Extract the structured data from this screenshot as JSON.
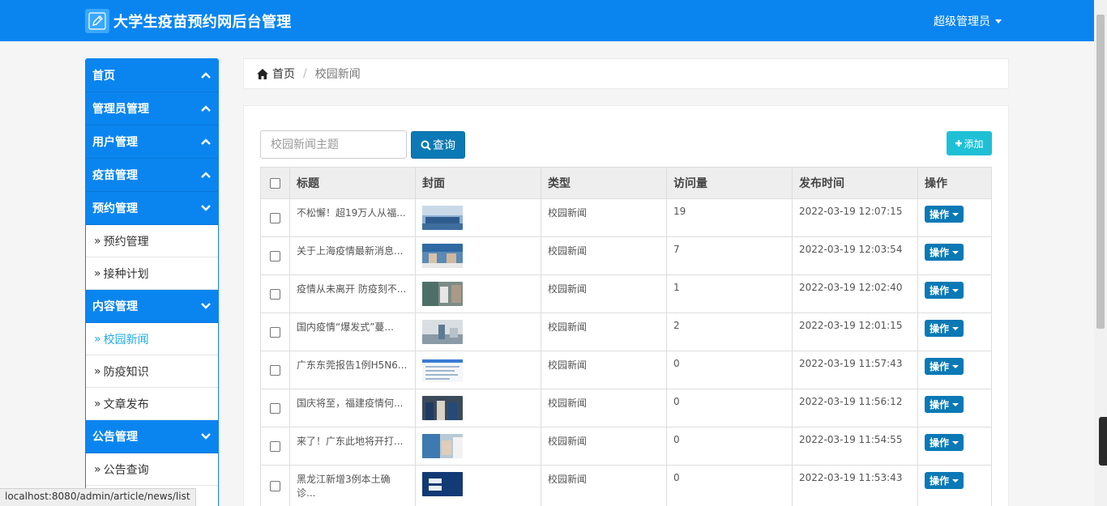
{
  "header": {
    "title": "大学生疫苗预约网后台管理",
    "user": "超级管理员"
  },
  "sidebar": {
    "sections": [
      {
        "label": "首页",
        "expanded": false,
        "items": []
      },
      {
        "label": "管理员管理",
        "expanded": false,
        "items": []
      },
      {
        "label": "用户管理",
        "expanded": false,
        "items": []
      },
      {
        "label": "疫苗管理",
        "expanded": false,
        "items": []
      },
      {
        "label": "预约管理",
        "expanded": true,
        "items": [
          "预约管理",
          "接种计划"
        ]
      },
      {
        "label": "内容管理",
        "expanded": true,
        "items": [
          "校园新闻",
          "防疫知识",
          "文章发布"
        ]
      },
      {
        "label": "公告管理",
        "expanded": true,
        "items": [
          "公告查询"
        ]
      }
    ],
    "active_item": "校园新闻"
  },
  "breadcrumb": {
    "home": "首页",
    "current": "校园新闻"
  },
  "search": {
    "placeholder": "校园新闻主题",
    "button": "查询"
  },
  "add_button": "添加",
  "table": {
    "columns": [
      "标题",
      "封面",
      "类型",
      "访问量",
      "发布时间",
      "操作"
    ],
    "rows": [
      {
        "title": "不松懈！超19万人从福...",
        "type": "校园新闻",
        "views": "19",
        "time": "2022-03-19 12:07:15",
        "action": "操作"
      },
      {
        "title": "关于上海疫情最新消息...",
        "type": "校园新闻",
        "views": "7",
        "time": "2022-03-19 12:03:54",
        "action": "操作"
      },
      {
        "title": "疫情从未离开 防疫刻不...",
        "type": "校园新闻",
        "views": "1",
        "time": "2022-03-19 12:02:40",
        "action": "操作"
      },
      {
        "title": "国内疫情“爆发式”蔓...",
        "type": "校园新闻",
        "views": "2",
        "time": "2022-03-19 12:01:15",
        "action": "操作"
      },
      {
        "title": "广东东莞报告1例H5N6...",
        "type": "校园新闻",
        "views": "0",
        "time": "2022-03-19 11:57:43",
        "action": "操作"
      },
      {
        "title": "国庆将至，福建疫情何...",
        "type": "校园新闻",
        "views": "0",
        "time": "2022-03-19 11:56:12",
        "action": "操作"
      },
      {
        "title": "来了！广东此地将开打...",
        "type": "校园新闻",
        "views": "0",
        "time": "2022-03-19 11:54:55",
        "action": "操作"
      },
      {
        "title": "黑龙江新增3例本土确诊...",
        "type": "校园新闻",
        "views": "0",
        "time": "2022-03-19 11:53:43",
        "action": "操作"
      }
    ]
  },
  "status_url": "localhost:8080/admin/article/news/list",
  "colors": {
    "primary": "#0a85f0",
    "button": "#0b79b5",
    "add": "#1fc0d6",
    "active_link": "#1eaae8"
  }
}
